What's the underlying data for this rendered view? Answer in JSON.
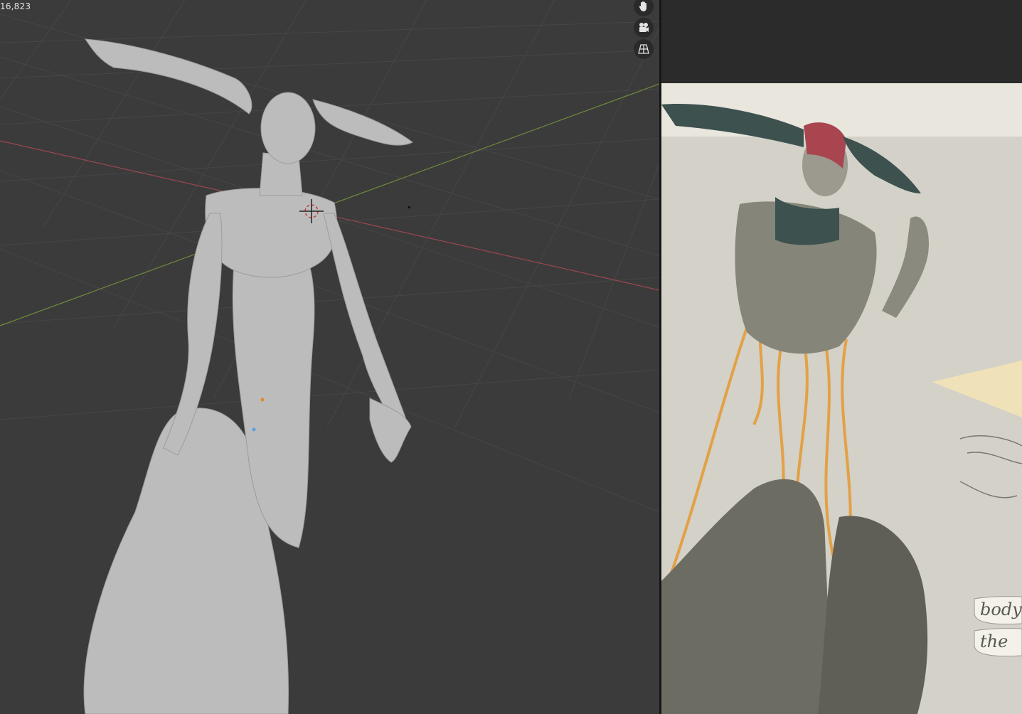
{
  "viewport": {
    "stats_text": "16,823",
    "colors": {
      "background": "#3b3b3b",
      "grid": "#474747",
      "x_axis": "#9a4750",
      "y_axis": "#6d8a3c",
      "sculpt": "#bcbcbc"
    },
    "nav_buttons": [
      {
        "icon": "hand-pan-icon"
      },
      {
        "icon": "camera-icon"
      },
      {
        "icon": "grid-perspective-icon"
      }
    ]
  },
  "image_editor": {
    "reference_text": [
      "body",
      "the"
    ],
    "colors": {
      "paper": "#e9e6dd",
      "figure": "#858679",
      "tendrils": "#e2a146",
      "horns": "#3d514f",
      "hair": "#a8454f"
    }
  }
}
